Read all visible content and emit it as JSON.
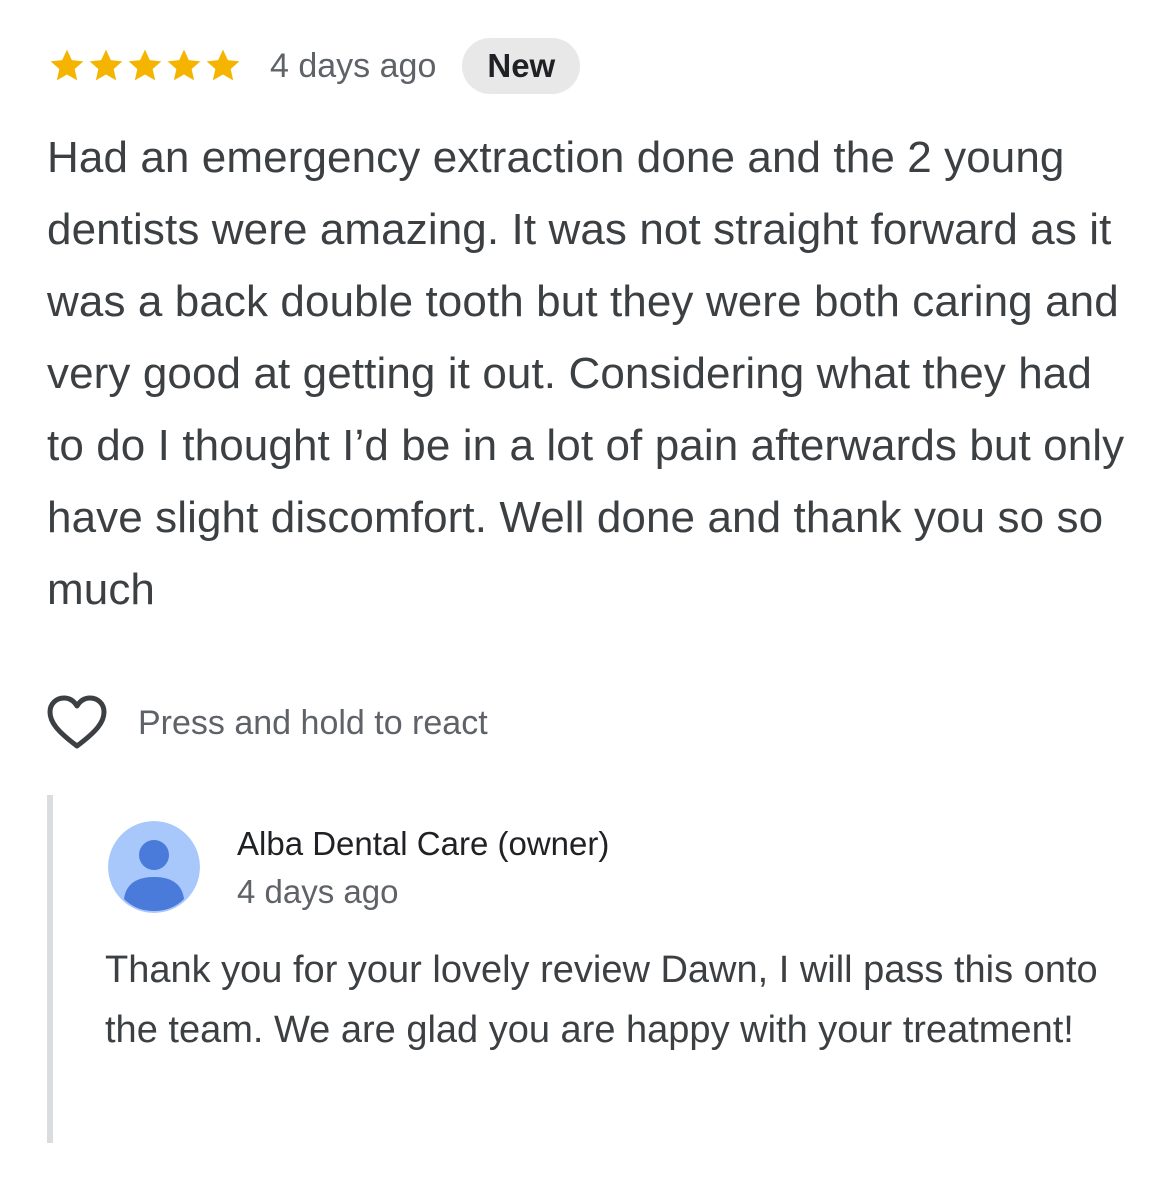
{
  "review": {
    "rating": 5,
    "max_rating": 5,
    "star_color": "#F4B400",
    "time": "4 days ago",
    "badge": "New",
    "text": "Had an emergency extraction done and the 2 young dentists were amazing. It was not straight forward as it was a back double tooth but they were both caring and very good at getting it out. Considering what they had to do I thought I’d be in a lot of pain afterwards but only have slight discomfort. Well done and thank you so so much"
  },
  "react": {
    "icon": "heart-outline-icon",
    "label": "Press and hold to react"
  },
  "owner_reply": {
    "name": "Alba Dental Care (owner)",
    "time": "4 days ago",
    "avatar_icon": "person-icon",
    "avatar_bg": "#A8C7FA",
    "avatar_fg": "#4A7BDB",
    "text": "Thank you for your lovely review Dawn, I will pass this onto the team. We are glad you are happy with your treatment!"
  }
}
